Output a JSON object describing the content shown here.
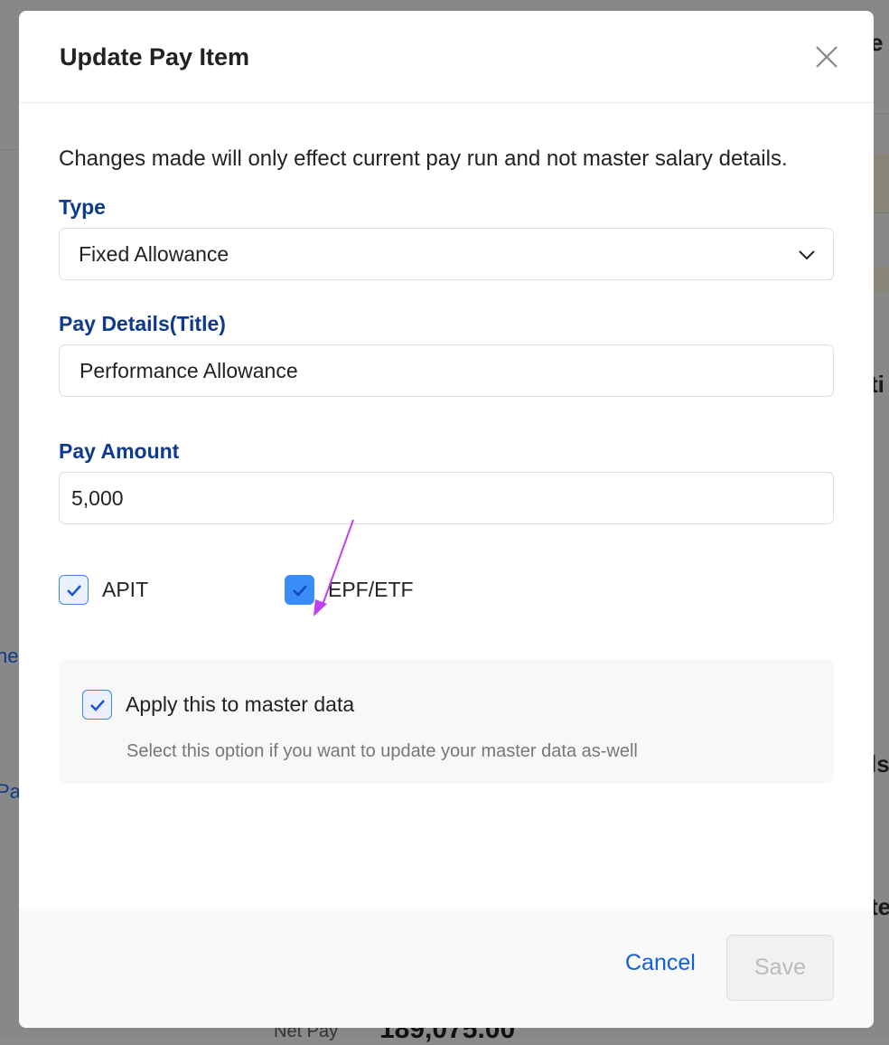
{
  "background": {
    "fragments": [
      "e",
      "ti",
      "ls",
      "te",
      "ne",
      "Pa"
    ],
    "net_pay_label": "Net Pay",
    "net_pay_value": "189,075.00"
  },
  "modal": {
    "title": "Update Pay Item",
    "note": "Changes made will only effect current pay run and not master salary details.",
    "type": {
      "label": "Type",
      "value": "Fixed Allowance"
    },
    "pay_details": {
      "label": "Pay Details(Title)",
      "value": "Performance Allowance"
    },
    "pay_amount": {
      "label": "Pay Amount",
      "value": "5,000"
    },
    "checkboxes": [
      {
        "label": "APIT",
        "checked": true
      },
      {
        "label": "EPF/ETF",
        "checked": true
      }
    ],
    "apply_master": {
      "label": "Apply this to master data",
      "checked": true,
      "hint": "Select this option if you want to update your master data as-well"
    },
    "cancel_label": "Cancel",
    "save_label": "Save",
    "annotation_arrow_color": "#c040f0"
  }
}
